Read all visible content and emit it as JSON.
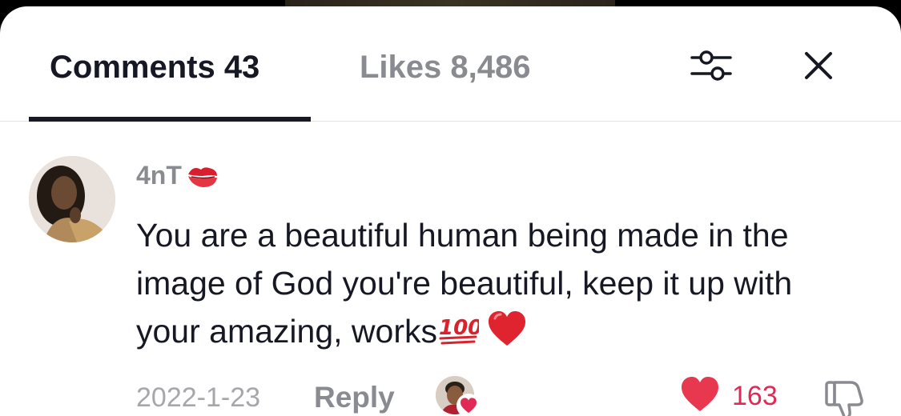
{
  "tabs": {
    "comments_label": "Comments 43",
    "likes_label": "Likes 8,486"
  },
  "header_icons": {
    "filter": "sliders-icon",
    "close": "close-icon"
  },
  "comment": {
    "username": "4nT",
    "username_emoji": "kiss-mark-icon",
    "text": "You are a beautiful human being made in the image of God you're beautiful, keep it up with your amazing, works",
    "trailing_emojis": [
      "hundred-points-icon",
      "red-heart-icon"
    ],
    "date": "2022-1-23",
    "reply_label": "Reply",
    "creator_liked": true,
    "like_count": "163",
    "liked": true
  },
  "colors": {
    "primary_text": "#161823",
    "secondary_text": "#8a8b91",
    "like_red": "#e02a55",
    "hundred_red": "#d8222c"
  }
}
